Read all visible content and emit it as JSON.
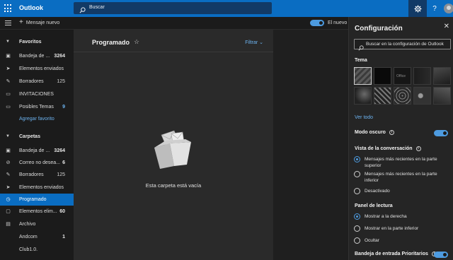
{
  "app": {
    "brand": "Outlook",
    "accent": "#0a6dc2",
    "link_color": "#6cb3f0"
  },
  "topbar": {
    "search_placeholder": "Buscar",
    "icons": [
      "waffle-icon",
      "search-icon",
      "gear-icon",
      "help-icon",
      "avatar"
    ],
    "help_label": "?"
  },
  "commandbar": {
    "new_mail_label": "Mensaje nuevo",
    "new_look_label": "El nuevo",
    "new_look_on": true
  },
  "sidebar": {
    "favorites_header": "Favoritos",
    "favorites": [
      {
        "label": "Bandeja de ...",
        "count": "3264",
        "icon": "inbox-icon"
      },
      {
        "label": "Elementos enviados",
        "count": "",
        "icon": "send-icon"
      },
      {
        "label": "Borradores",
        "count": "125",
        "icon": "pencil-icon"
      },
      {
        "label": "INVITACIONES",
        "count": "",
        "icon": "folder-icon"
      },
      {
        "label": "Posibles Temas",
        "count": "9",
        "icon": "folder-icon"
      }
    ],
    "add_favorite": "Agregar favorito",
    "folders_header": "Carpetas",
    "folders": [
      {
        "label": "Bandeja de ...",
        "count": "3264",
        "icon": "inbox-icon"
      },
      {
        "label": "Correo no desea...",
        "count": "6",
        "icon": "block-icon"
      },
      {
        "label": "Borradores",
        "count": "125",
        "icon": "pencil-icon"
      },
      {
        "label": "Elementos enviados",
        "count": "",
        "icon": "send-icon"
      },
      {
        "label": "Programado",
        "count": "",
        "icon": "clock-icon",
        "active": true
      },
      {
        "label": "Elementos elim...",
        "count": "60",
        "icon": "trash-icon"
      },
      {
        "label": "Archivo",
        "count": "",
        "icon": "archive-icon"
      },
      {
        "label": "Andcom",
        "count": "1",
        "icon": ""
      },
      {
        "label": "Club1.0.",
        "count": "",
        "icon": ""
      }
    ]
  },
  "message_list": {
    "title": "Programado",
    "filter_label": "Filtrar",
    "empty_text": "Esta carpeta está vacía"
  },
  "settings": {
    "title": "Configuración",
    "search_placeholder": "Buscar en la configuración de Outlook",
    "theme_header": "Tema",
    "theme_labels": {
      "office": "Office"
    },
    "see_all": "Ver todo",
    "dark_mode_label": "Modo oscuro",
    "dark_mode_on": true,
    "conversation_header": "Vista de la conversación",
    "conversation_options": [
      {
        "label": "Mensajes más recientes en la parte superior",
        "selected": true
      },
      {
        "label": "Mensajes más recientes en la parte inferior",
        "selected": false
      },
      {
        "label": "Desactivado",
        "selected": false
      }
    ],
    "reading_header": "Panel de lectura",
    "reading_options": [
      {
        "label": "Mostrar a la derecha",
        "selected": true
      },
      {
        "label": "Mostrar en la parte inferior",
        "selected": false
      },
      {
        "label": "Ocultar",
        "selected": false
      }
    ],
    "focused_inbox_label": "Bandeja de entrada Prioritarios",
    "focused_inbox_on": true
  }
}
